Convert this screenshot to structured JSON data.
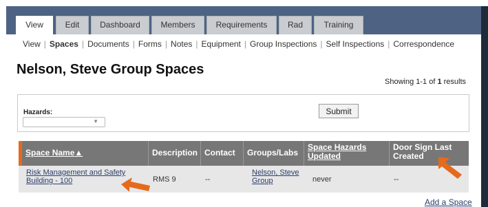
{
  "tabs": [
    {
      "label": "View",
      "active": true
    },
    {
      "label": "Edit"
    },
    {
      "label": "Dashboard"
    },
    {
      "label": "Members"
    },
    {
      "label": "Requirements"
    },
    {
      "label": "Rad"
    },
    {
      "label": "Training"
    }
  ],
  "subnav": [
    "View",
    "Spaces",
    "Documents",
    "Forms",
    "Notes",
    "Equipment",
    "Group Inspections",
    "Self Inspections",
    "Correspondence"
  ],
  "subnav_active": "Spaces",
  "page_title": "Nelson, Steve Group Spaces",
  "results": {
    "prefix": "Showing 1-1 of ",
    "total": "1",
    "suffix": " results"
  },
  "filter": {
    "hazards_label": "Hazards:",
    "hazards_value": "",
    "submit_label": "Submit"
  },
  "table": {
    "columns": [
      "Space Name▲",
      "Description",
      "Contact",
      "Groups/Labs",
      "Space Hazards Updated",
      "Door Sign Last Created"
    ],
    "rows": [
      [
        "Risk Management and Safety Building - 100",
        "RMS 9",
        "--",
        "Nelson, Steve Group",
        "never",
        "--"
      ]
    ]
  },
  "add_space_label": "Add a Space",
  "colors": {
    "top_band": "#4e6383",
    "header": "#777777",
    "accent": "#e56a1c",
    "row": "#e7e7e7",
    "link": "#2a3d6b"
  },
  "annotations": [
    "orange-arrow-pointing-space-name",
    "orange-arrow-pointing-door-sign"
  ]
}
